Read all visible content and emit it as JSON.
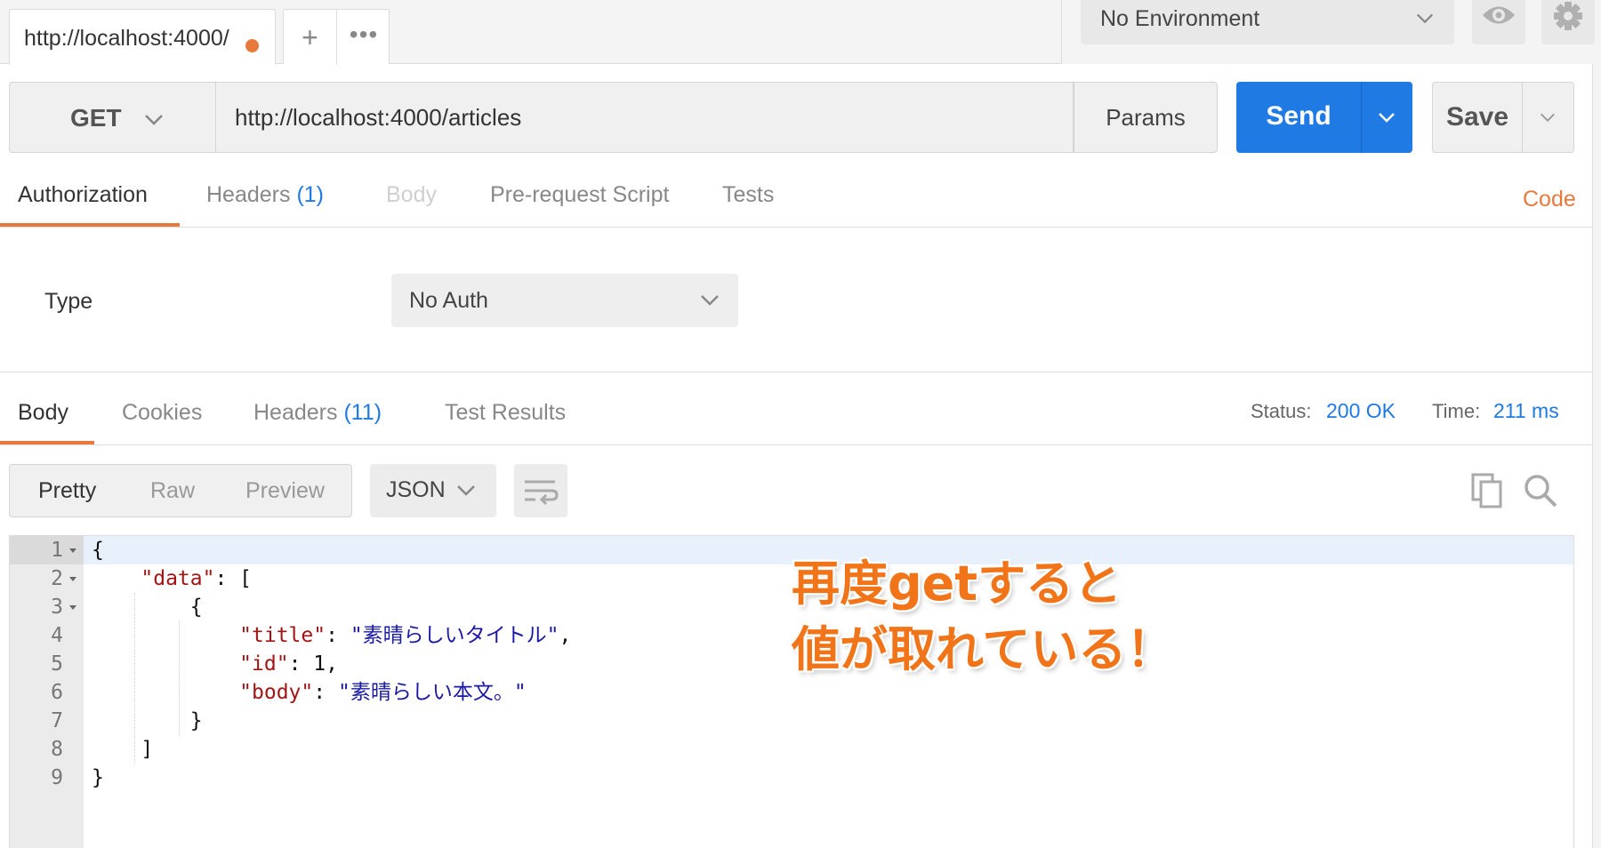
{
  "tabs": {
    "active_label": "http://localhost:4000/",
    "new_tab_glyph": "+",
    "more_glyph": "•••"
  },
  "environment": {
    "selected": "No Environment"
  },
  "request": {
    "method": "GET",
    "url": "http://localhost:4000/articles",
    "params_label": "Params",
    "send_label": "Send",
    "save_label": "Save"
  },
  "request_tabs": [
    {
      "label": "Authorization",
      "count": ""
    },
    {
      "label": "Headers",
      "count": "(1)"
    },
    {
      "label": "Body",
      "count": ""
    },
    {
      "label": "Pre-request Script",
      "count": ""
    },
    {
      "label": "Tests",
      "count": ""
    }
  ],
  "code_link": "Code",
  "auth": {
    "type_label": "Type",
    "selected": "No Auth"
  },
  "response_tabs": [
    {
      "label": "Body",
      "count": ""
    },
    {
      "label": "Cookies",
      "count": ""
    },
    {
      "label": "Headers",
      "count": "(11)"
    },
    {
      "label": "Test Results",
      "count": ""
    }
  ],
  "response_meta": {
    "status_label": "Status:",
    "status_value": "200 OK",
    "time_label": "Time:",
    "time_value": "211 ms"
  },
  "view_modes": [
    "Pretty",
    "Raw",
    "Preview"
  ],
  "format": "JSON",
  "editor": {
    "line_numbers": [
      "1",
      "2",
      "3",
      "4",
      "5",
      "6",
      "7",
      "8",
      "9"
    ],
    "lines": [
      {
        "indent": "",
        "parts": [
          {
            "t": "n",
            "v": "{"
          }
        ]
      },
      {
        "indent": "    ",
        "parts": [
          {
            "t": "k",
            "v": "\"data\""
          },
          {
            "t": "n",
            "v": ": ["
          }
        ]
      },
      {
        "indent": "        ",
        "parts": [
          {
            "t": "n",
            "v": "{"
          }
        ]
      },
      {
        "indent": "            ",
        "parts": [
          {
            "t": "k",
            "v": "\"title\""
          },
          {
            "t": "n",
            "v": ": "
          },
          {
            "t": "s",
            "v": "\"素晴らしいタイトル\""
          },
          {
            "t": "n",
            "v": ","
          }
        ]
      },
      {
        "indent": "            ",
        "parts": [
          {
            "t": "k",
            "v": "\"id\""
          },
          {
            "t": "n",
            "v": ": 1,"
          }
        ]
      },
      {
        "indent": "            ",
        "parts": [
          {
            "t": "k",
            "v": "\"body\""
          },
          {
            "t": "n",
            "v": ": "
          },
          {
            "t": "s",
            "v": "\"素晴らしい本文。\""
          }
        ]
      },
      {
        "indent": "        ",
        "parts": [
          {
            "t": "n",
            "v": "}"
          }
        ]
      },
      {
        "indent": "    ",
        "parts": [
          {
            "t": "n",
            "v": "]"
          }
        ]
      },
      {
        "indent": "",
        "parts": [
          {
            "t": "n",
            "v": "}"
          }
        ]
      }
    ]
  },
  "annotation": {
    "line1": "再度getすると",
    "line2": "値が取れている！"
  },
  "colors": {
    "accent": "#e8793d",
    "send": "#1f7ae4",
    "json_key": "#a31515",
    "json_string": "#1a1aa6",
    "annotation": "#f27418"
  },
  "icons": {
    "eye": "eye-icon",
    "gear": "gear-icon",
    "wrap": "wrap-lines-icon",
    "copy": "copy-icon",
    "search": "search-icon"
  }
}
